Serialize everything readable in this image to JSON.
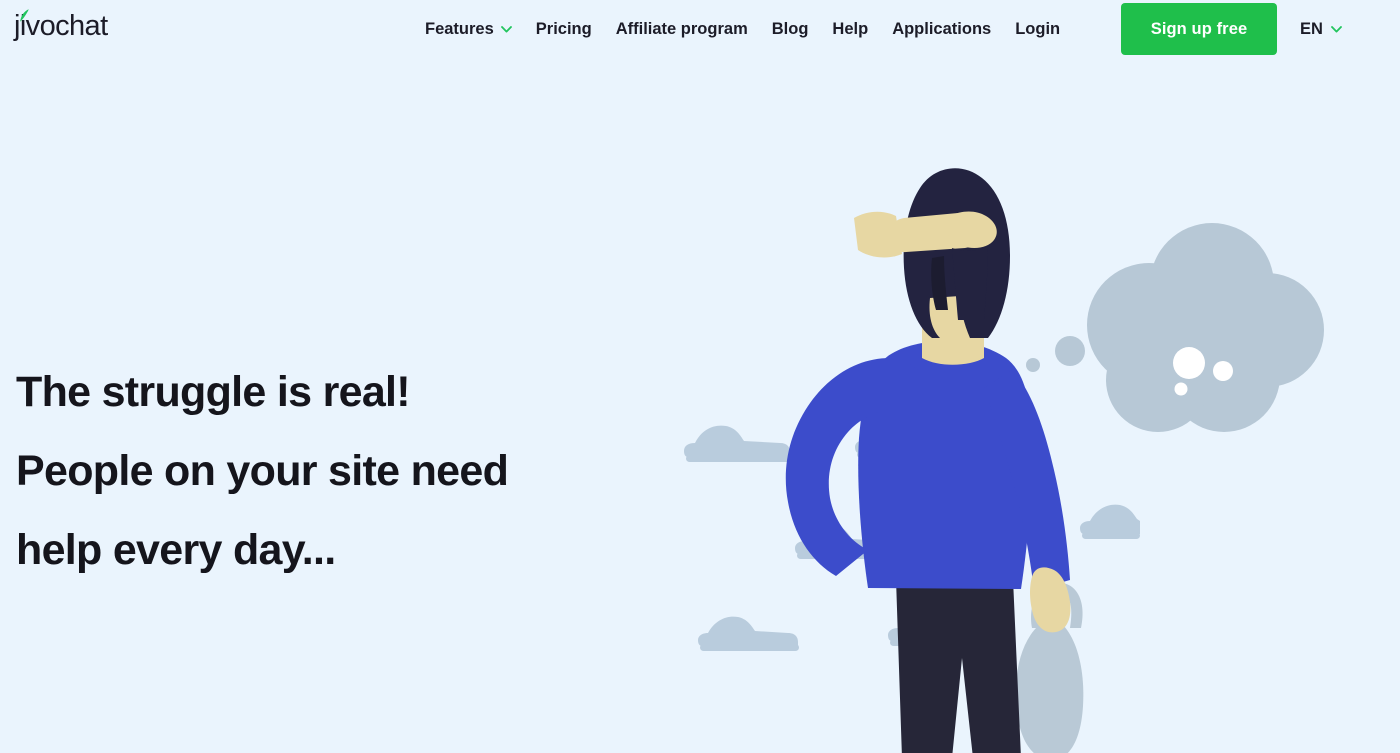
{
  "site": {
    "brand": "jivochat",
    "background_color": "#EAF4FD",
    "accent_green": "#1FBF4B",
    "text_color": "#15151C"
  },
  "header": {
    "logo_label": "jivochat",
    "logo_leaf_icon": "leaf-icon",
    "nav": [
      {
        "label": "Features",
        "has_dropdown": true,
        "icon": "chevron-down-icon"
      },
      {
        "label": "Pricing",
        "has_dropdown": false
      },
      {
        "label": "Affiliate program",
        "has_dropdown": false
      },
      {
        "label": "Blog",
        "has_dropdown": false
      },
      {
        "label": "Help",
        "has_dropdown": false
      },
      {
        "label": "Applications",
        "has_dropdown": false
      },
      {
        "label": "Login",
        "has_dropdown": false
      }
    ],
    "signup_label": "Sign up free",
    "language": {
      "selected": "EN",
      "icon": "chevron-down-icon"
    }
  },
  "hero": {
    "heading_lines": [
      "The struggle is real!",
      "People on your site need",
      "help every day..."
    ],
    "illustration": {
      "name": "confused-shopper-illustration",
      "description": "Man seen from behind with hand on forehead holding a shopping bag, with a thought bubble",
      "colors": {
        "shirt": "#3C4CCB",
        "pants": "#262638",
        "hair": "#232340",
        "skin": "#E7D7A3",
        "bubble": "#B7C8D6",
        "bag": "#B9C9D6",
        "ground_shapes": "#B9CCDD"
      }
    }
  }
}
